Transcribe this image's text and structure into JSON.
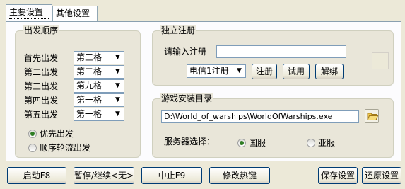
{
  "tabs": [
    {
      "label": "主要设置"
    },
    {
      "label": "其他设置"
    }
  ],
  "departure": {
    "title": "出发顺序",
    "rows": [
      {
        "label": "首先出发",
        "value": "第三格"
      },
      {
        "label": "第二出发",
        "value": "第二格"
      },
      {
        "label": "第三出发",
        "value": "第九格"
      },
      {
        "label": "第四出发",
        "value": "第一格"
      },
      {
        "label": "第五出发",
        "value": "第一格"
      }
    ],
    "radio_priority": "优先出发",
    "radio_rotate": "顺序轮流出发",
    "selected_mode": "优先出发"
  },
  "registration": {
    "title": "独立注册",
    "prompt": "请输入注册",
    "code_value": "",
    "server_option": "电信1注册",
    "register_label": "注册",
    "trial_label": "试用",
    "unbind_label": "解绑"
  },
  "install": {
    "title": "游戏安装目录",
    "path": "D:\\World_of_warships\\WorldOfWarships.exe",
    "server_label": "服务器选择：",
    "server_cn": "国服",
    "server_asia": "亚服",
    "selected_server": "国服"
  },
  "bottom": {
    "start": "启动F8",
    "pause": "暂停/继续<无>",
    "stop": "中止F9",
    "hotkey": "修改热键",
    "save": "保存设置",
    "restore": "还原设置"
  },
  "colors": {
    "accent": "#2f7d24",
    "border": "#003c74"
  }
}
